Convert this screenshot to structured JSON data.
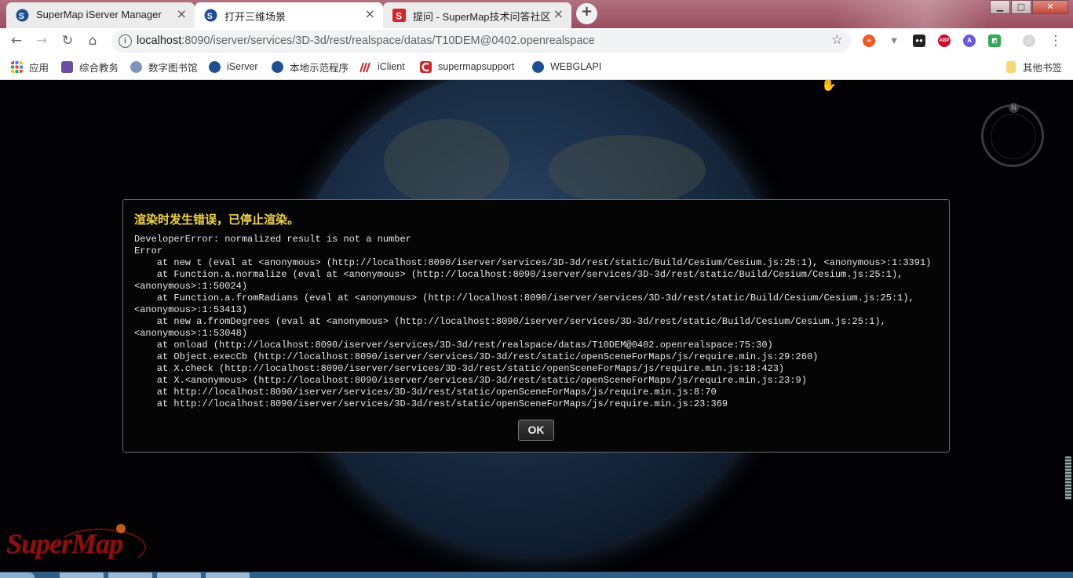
{
  "browser": {
    "tabs": [
      {
        "title": "SuperMap iServer Manager",
        "active": false
      },
      {
        "title": "打开三维场景",
        "active": true
      },
      {
        "title": "提问 - SuperMap技术问答社区",
        "active": false
      }
    ],
    "close_glyph": "×",
    "new_tab_glyph": "+",
    "window_controls": {
      "minimize": "▁",
      "maximize": "□",
      "close": "✕"
    },
    "address": {
      "host": "localhost",
      "path": ":8090/iserver/services/3D-3d/rest/realspace/datas/T10DEM@0402.openrealspace"
    },
    "nav_glyphs": {
      "back": "←",
      "forward": "→",
      "reload": "↻",
      "home": "⌂",
      "info": "i",
      "star": "☆",
      "menu": "⋮"
    },
    "extensions": [
      {
        "name": "infinity-extension-icon",
        "color": "#f0592a",
        "glyph": "∞"
      },
      {
        "name": "vue-devtools-icon",
        "color": "#8a8a8a",
        "glyph": "▼"
      },
      {
        "name": "tampermonkey-icon",
        "color": "#222222",
        "glyph": "●●"
      },
      {
        "name": "adblock-plus-icon",
        "color": "#c70d2c",
        "glyph": "ABP"
      },
      {
        "name": "a-extension-icon",
        "color": "#6d5ad8",
        "glyph": "A"
      },
      {
        "name": "color-extension-icon",
        "color": "#34a853",
        "glyph": "◩"
      },
      {
        "name": "profile-avatar-icon",
        "color": "#d8d8d8",
        "glyph": "☼"
      }
    ]
  },
  "bookmarks": {
    "items": [
      {
        "label": "应用",
        "color": "#d0452e"
      },
      {
        "label": "综合教务",
        "color": "#6b4fa0"
      },
      {
        "label": "数字图书馆",
        "color": "#3f6fb0"
      },
      {
        "label": "iServer",
        "color": "#1f4f8f"
      },
      {
        "label": "本地示范程序",
        "color": "#1f4f8f"
      },
      {
        "label": "iClient",
        "color": "#c8292f"
      },
      {
        "label": "supermapsupport",
        "color": "#c8292f"
      },
      {
        "label": "WEBGLAPI",
        "color": "#1f4f8f"
      }
    ],
    "other": "其他书签"
  },
  "scene": {
    "compass_label": "N",
    "logo_text": "SuperMap"
  },
  "dialog": {
    "title": "渲染时发生错误，已停止渲染。",
    "message": "DeveloperError: normalized result is not a number\nError\n    at new t (eval at <anonymous> (http://localhost:8090/iserver/services/3D-3d/rest/static/Build/Cesium/Cesium.js:25:1), <anonymous>:1:3391)\n    at Function.a.normalize (eval at <anonymous> (http://localhost:8090/iserver/services/3D-3d/rest/static/Build/Cesium/Cesium.js:25:1),\n<anonymous>:1:50024)\n    at Function.a.fromRadians (eval at <anonymous> (http://localhost:8090/iserver/services/3D-3d/rest/static/Build/Cesium/Cesium.js:25:1),\n<anonymous>:1:53413)\n    at new a.fromDegrees (eval at <anonymous> (http://localhost:8090/iserver/services/3D-3d/rest/static/Build/Cesium/Cesium.js:25:1),\n<anonymous>:1:53048)\n    at onload (http://localhost:8090/iserver/services/3D-3d/rest/realspace/datas/T10DEM@0402.openrealspace:75:30)\n    at Object.execCb (http://localhost:8090/iserver/services/3D-3d/rest/static/openSceneForMaps/js/require.min.js:29:260)\n    at X.check (http://localhost:8090/iserver/services/3D-3d/rest/static/openSceneForMaps/js/require.min.js:18:423)\n    at X.<anonymous> (http://localhost:8090/iserver/services/3D-3d/rest/static/openSceneForMaps/js/require.min.js:23:9)\n    at http://localhost:8090/iserver/services/3D-3d/rest/static/openSceneForMaps/js/require.min.js:8:70\n    at http://localhost:8090/iserver/services/3D-3d/rest/static/openSceneForMaps/js/require.min.js:23:369",
    "ok_label": "OK"
  }
}
